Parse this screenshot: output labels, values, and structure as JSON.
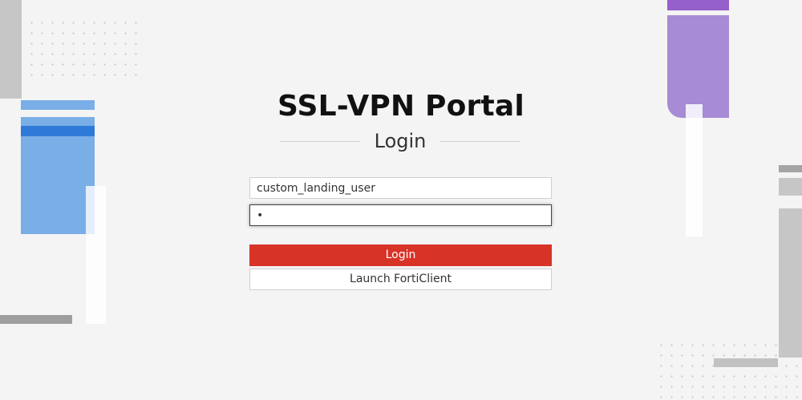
{
  "portal": {
    "title": "SSL-VPN Portal",
    "subtitle": "Login"
  },
  "form": {
    "username_value": "custom_landing_user",
    "password_value": "•",
    "login_label": "Login",
    "forticlient_label": "Launch FortiClient"
  },
  "colors": {
    "login_button": "#d83327",
    "background": "#f4f4f4",
    "accent_blue": "#7aaee6",
    "accent_purple": "#a78bd4"
  }
}
